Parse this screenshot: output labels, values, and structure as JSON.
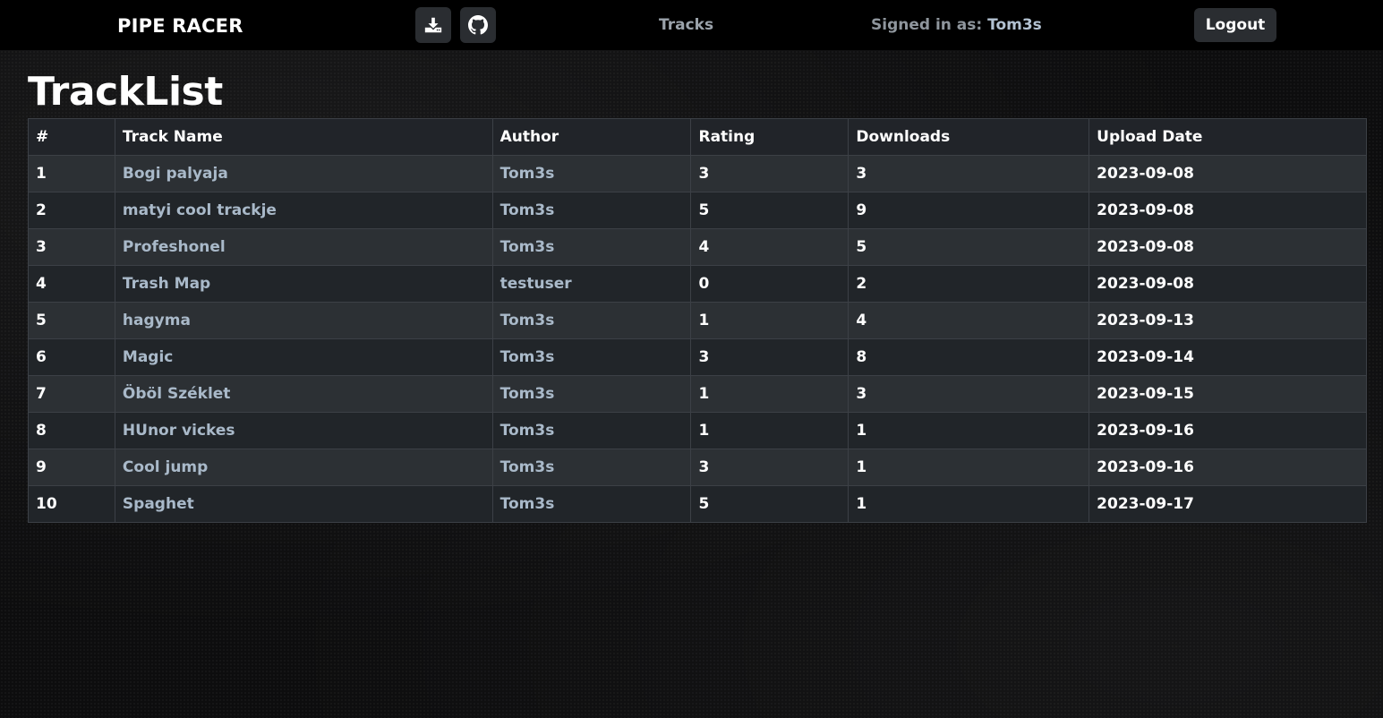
{
  "header": {
    "brand": "PIPE RACER",
    "nav_tracks": "Tracks",
    "signed_in_prefix": "Signed in as: ",
    "signed_in_user": "Tom3s",
    "logout_label": "Logout",
    "icons": [
      "download-icon",
      "github-icon"
    ]
  },
  "main": {
    "title": "TrackList",
    "columns": [
      "#",
      "Track Name",
      "Author",
      "Rating",
      "Downloads",
      "Upload Date"
    ],
    "rows": [
      {
        "num": "1",
        "name": "Bogi palyaja",
        "author": "Tom3s",
        "rating": "3",
        "downloads": "3",
        "date": "2023-09-08"
      },
      {
        "num": "2",
        "name": "matyi cool trackje",
        "author": "Tom3s",
        "rating": "5",
        "downloads": "9",
        "date": "2023-09-08"
      },
      {
        "num": "3",
        "name": "Profeshonel",
        "author": "Tom3s",
        "rating": "4",
        "downloads": "5",
        "date": "2023-09-08"
      },
      {
        "num": "4",
        "name": "Trash Map",
        "author": "testuser",
        "rating": "0",
        "downloads": "2",
        "date": "2023-09-08"
      },
      {
        "num": "5",
        "name": "hagyma",
        "author": "Tom3s",
        "rating": "1",
        "downloads": "4",
        "date": "2023-09-13"
      },
      {
        "num": "6",
        "name": "Magic",
        "author": "Tom3s",
        "rating": "3",
        "downloads": "8",
        "date": "2023-09-14"
      },
      {
        "num": "7",
        "name": "Öböl Széklet",
        "author": "Tom3s",
        "rating": "1",
        "downloads": "3",
        "date": "2023-09-15"
      },
      {
        "num": "8",
        "name": "HUnor vickes",
        "author": "Tom3s",
        "rating": "1",
        "downloads": "1",
        "date": "2023-09-16"
      },
      {
        "num": "9",
        "name": "Cool jump",
        "author": "Tom3s",
        "rating": "3",
        "downloads": "1",
        "date": "2023-09-16"
      },
      {
        "num": "10",
        "name": "Spaghet",
        "author": "Tom3s",
        "rating": "5",
        "downloads": "1",
        "date": "2023-09-17"
      }
    ]
  },
  "colors": {
    "background": "#0d0d0e",
    "navbar": "#000000",
    "button": "#2a2d31",
    "link": "#a9b9c9",
    "row_odd": "#2c3034",
    "row_even": "#212529",
    "border": "#3c4046"
  }
}
